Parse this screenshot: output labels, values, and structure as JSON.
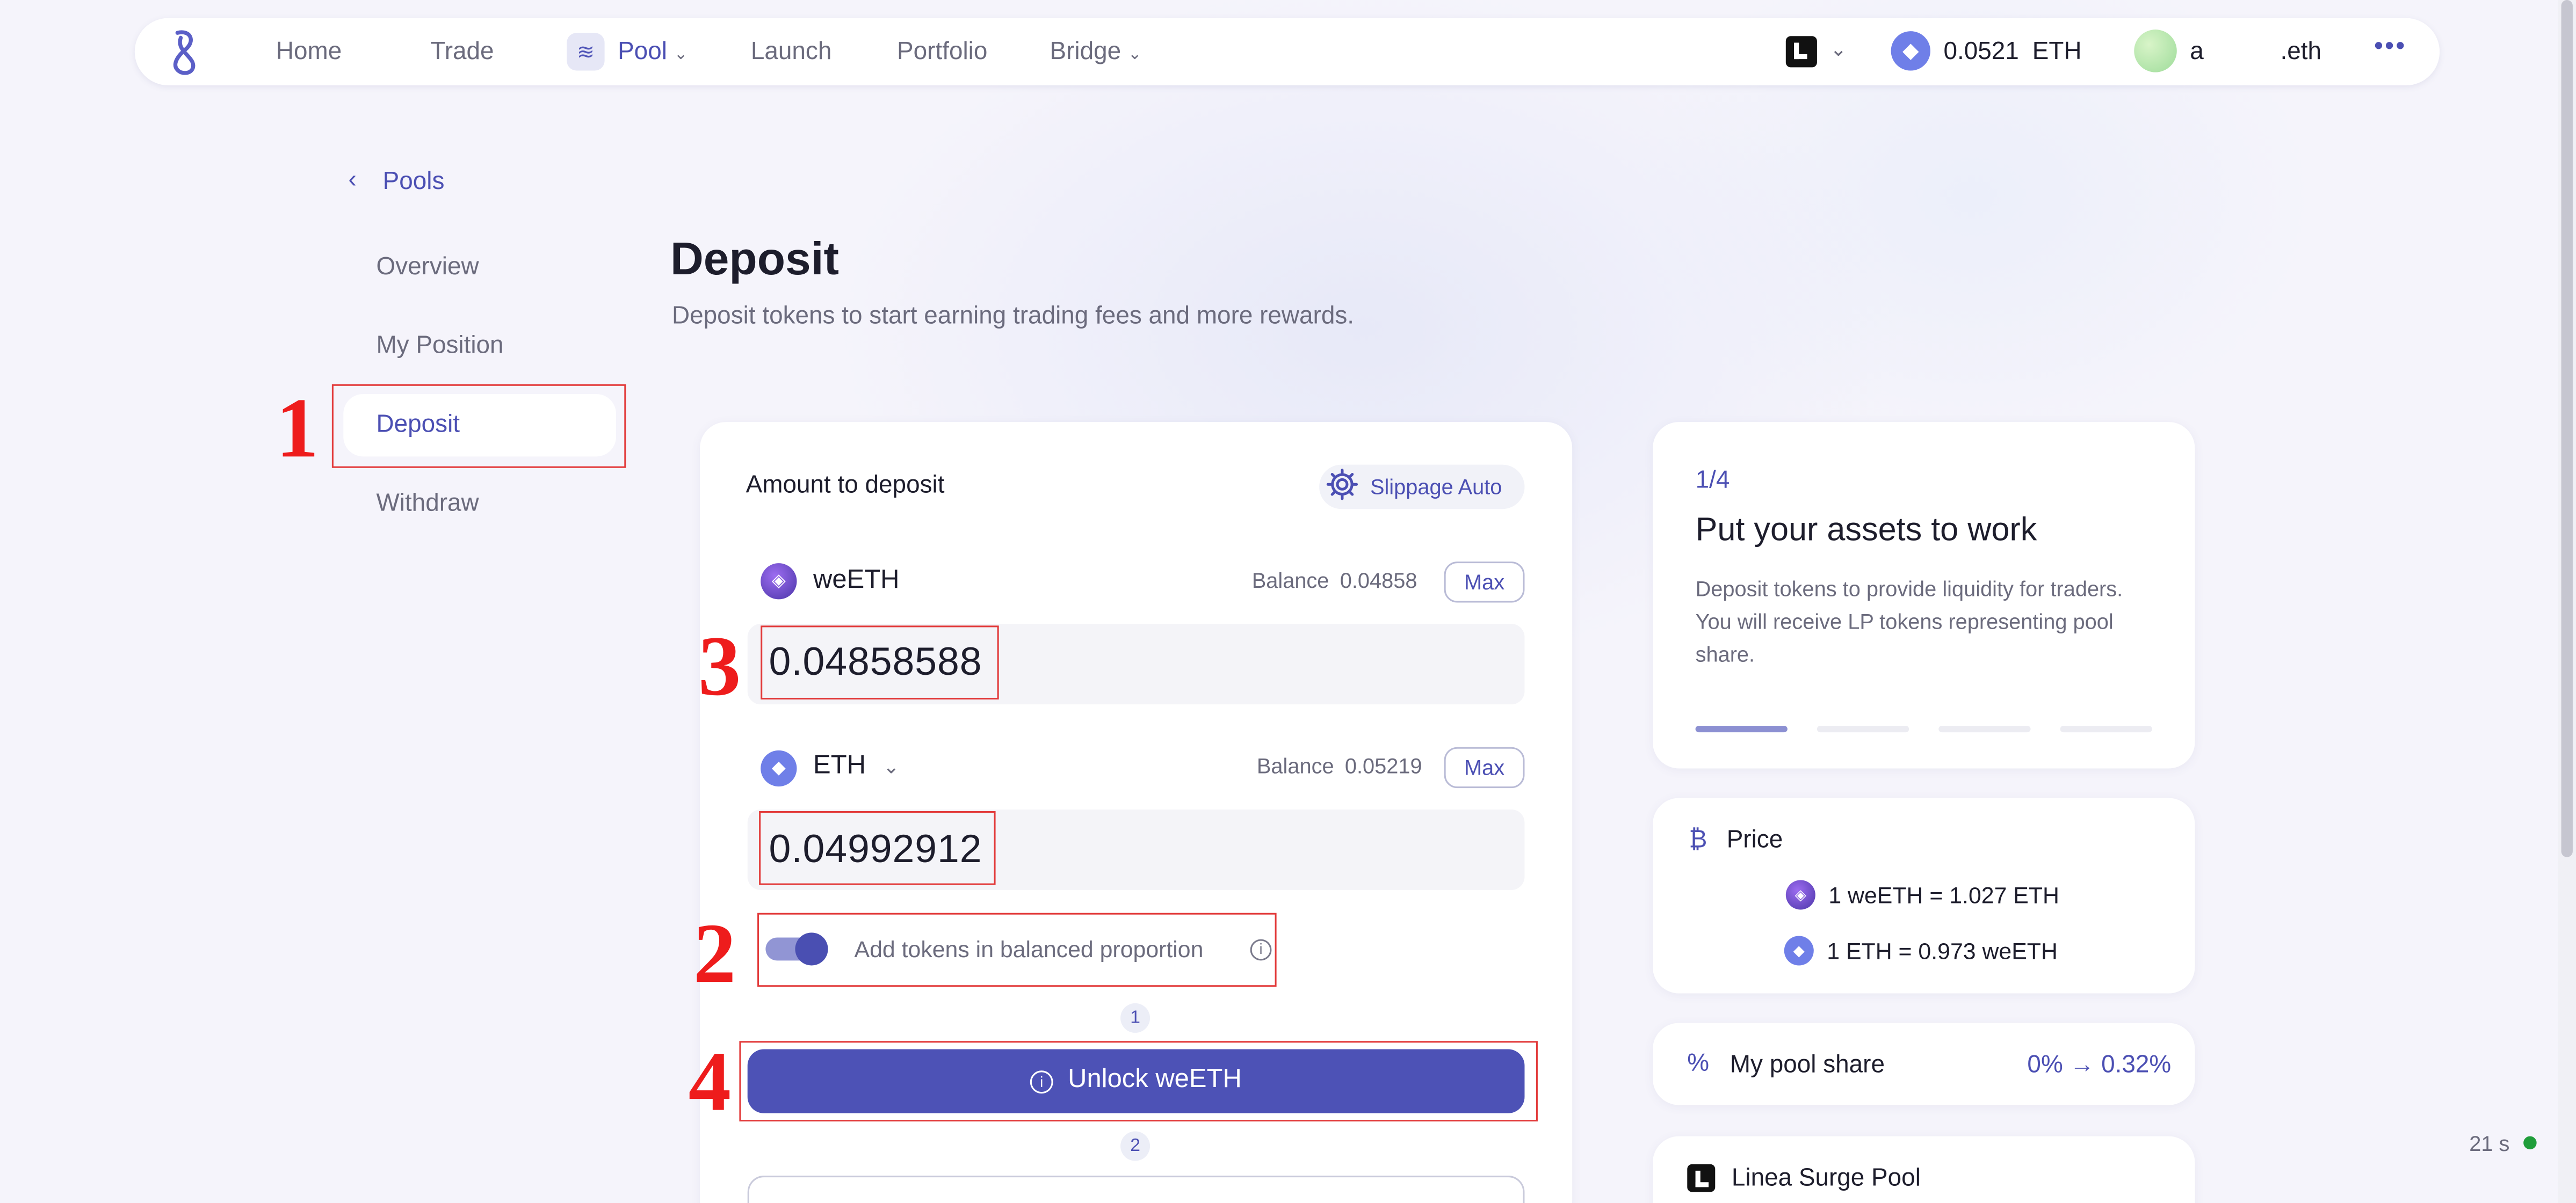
{
  "nav": {
    "items": [
      "Home",
      "Trade",
      "Pool",
      "Launch",
      "Portfolio",
      "Bridge"
    ],
    "balance_amount": "0.0521",
    "balance_unit": "ETH",
    "account_name": "a",
    "account_suffix": ".eth",
    "more": "•••"
  },
  "sidebar": {
    "back": "Pools",
    "items": [
      "Overview",
      "My Position",
      "Deposit",
      "Withdraw"
    ]
  },
  "page": {
    "title": "Deposit",
    "subtitle": "Deposit tokens to start earning trading fees and more rewards."
  },
  "deposit": {
    "heading": "Amount to deposit",
    "slippage": "Slippage Auto",
    "token1": {
      "symbol": "weETH",
      "balance_label": "Balance",
      "balance": "0.04858",
      "max": "Max",
      "amount": "0.04858588"
    },
    "token2": {
      "symbol": "ETH",
      "balance_label": "Balance",
      "balance": "0.05219",
      "max": "Max",
      "amount": "0.04992912"
    },
    "toggle_label": "Add tokens in balanced proportion",
    "toggle_on": true,
    "step1": "1",
    "unlock_button": "Unlock weETH",
    "step2": "2"
  },
  "info": {
    "step": "1/4",
    "title": "Put your assets to work",
    "text": "Deposit tokens to provide liquidity for traders. You will receive LP tokens representing pool share.",
    "progress_step": 1,
    "progress_total": 4
  },
  "price": {
    "label": "Price",
    "rate1": "1 weETH = 1.027 ETH",
    "rate2": "1 ETH = 0.973 weETH"
  },
  "share": {
    "label": "My pool share",
    "value": "0% → 0.32%"
  },
  "surge": {
    "label": "Linea Surge Pool"
  },
  "status": {
    "timer": "21 s",
    "dot_color": "#1f9d3a"
  },
  "annotations": [
    "1",
    "2",
    "3",
    "4"
  ],
  "colors": {
    "accent": "#4d52b6",
    "annotation_red": "#ee1c1c"
  }
}
